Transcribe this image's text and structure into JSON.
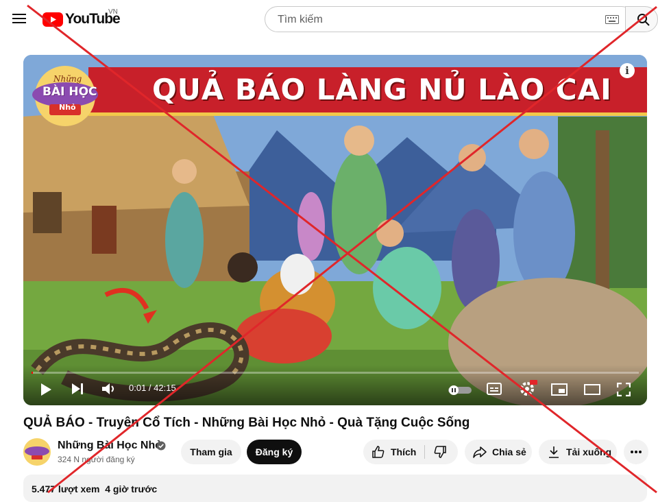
{
  "header": {
    "logo_text": "YouTube",
    "region": "VN",
    "search_placeholder": "Tìm kiếm"
  },
  "video": {
    "banner_title": "QUẢ BÁO LÀNG NỦ LÀO CAI",
    "channel_logo": {
      "line1": "Những",
      "line2": "BÀI HỌC",
      "line3": "Nhỏ"
    },
    "current_time": "0:01",
    "duration": "42:15",
    "time_display": "0:01 / 42:15",
    "progress_fraction": 0.0004
  },
  "meta": {
    "title": "QUẢ BÁO - Truyện Cổ Tích - Những Bài Học Nhỏ - Quà Tặng Cuộc Sống",
    "channel_name": "Những Bài Học Nhỏ",
    "subscribers": "324 N người đăng ký",
    "join_label": "Tham gia",
    "subscribe_label": "Đăng ký",
    "like_label": "Thích",
    "share_label": "Chia sẻ",
    "download_label": "Tải xuống",
    "views": "5.477 lượt xem",
    "posted": "4 giờ trước",
    "views_line": "5.477 lượt xem  4 giờ trước"
  },
  "colors": {
    "brand_red": "#ff0000",
    "cross_red": "#e0262a",
    "banner_red": "#c8202a"
  }
}
